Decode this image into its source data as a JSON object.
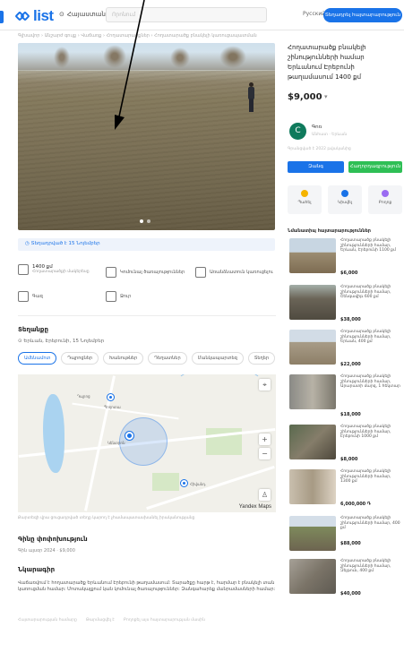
{
  "header": {
    "logo_text": "list",
    "location": "Հայաստան",
    "search_placeholder": "Որոնում",
    "language": "Русский",
    "post_button": "Տեղադրել հայտարարություն"
  },
  "breadcrumb": "Գլխավոր › Անշարժ գույք › Վաճառք › Հողատարածքներ › Հողատարածք բնակելի կառուցապատման",
  "listing": {
    "title": "Հողատարածք բնակելի շինությունների համար Երևանում Էրեբունի թաղամասում 1400 քմ",
    "price": "$9,000",
    "price_caret": "▾",
    "date_line": "Տեղադրված է 15 Նոյեմբեր",
    "features": [
      {
        "value": "1400 քմ",
        "sub": "Հողատարածքի մակերեսը",
        "icon": "area-icon"
      },
      {
        "value": "",
        "sub": "Կոմունալ ծառայություններ",
        "icon": "utilities-icon"
      },
      {
        "value": "",
        "sub": "Առանձնատուն կառուցելու",
        "icon": "house-icon"
      },
      {
        "value": "",
        "sub": "Գազ",
        "icon": "gas-icon"
      },
      {
        "value": "",
        "sub": "Ջուր",
        "icon": "water-icon"
      }
    ]
  },
  "location_section": {
    "title": "Տեղանքը",
    "address": "Երևան, Էրեբունի, 15 Նոյեմբեր",
    "tabs": [
      "Ամենամոտ",
      "Դպրոցներ",
      "Խանութներ",
      "Դեղատներ",
      "Մանկապարտեզ",
      "Տեղեր"
    ],
    "map_labels": [
      "Դպրոց",
      "Պողոտա",
      "Կենտրոն",
      "Հիվանդ."
    ],
    "map_brand": "Yandex Maps",
    "map_note": "Քարտեզի վրա ցուցադրված տեղը կարող է չհամապատասխանել իրականությանը"
  },
  "exchange_section": {
    "title": "Գինը փոփոխություն",
    "line": "Գին այսօր 2024 · $9,000"
  },
  "description_section": {
    "title": "Նկարագիր",
    "text": "Վաճառվում է հողատարածք Երևանում Էրեբունի թաղամասում: Տարածքը հարթ է, հարմար է բնակելի տան կառուցման համար: Մոտակայքում կան կոմունալ ծառայություններ: Զանգահարեք մանրամասների համար:",
    "footer_links": [
      "Հայտարարության համարը",
      "Թարմացվել է",
      "Բողոքել այս հայտարարության մասին"
    ]
  },
  "seller": {
    "avatar_letter": "C",
    "name": "Գոռ",
    "sub": "Անհատ · Երևան",
    "meta": "Գրանցված է 2022 թվականից"
  },
  "buttons": {
    "call": "Զանգ",
    "message": "Հաղորդագրություն"
  },
  "actions": [
    {
      "label": "Պահել",
      "icon": "star-icon",
      "color": "#f5b400"
    },
    {
      "label": "Կիսվել",
      "icon": "share-icon",
      "color": "#1a73e8"
    },
    {
      "label": "Բողոք",
      "icon": "flag-icon",
      "color": "#9b6cf2"
    }
  ],
  "similar": {
    "title": "Նմանատիպ հայտարարություններ",
    "items": [
      {
        "text": "Հողատարածք բնակելի շինությունների համար, Երևան, Էրեբունի 1100 քմ",
        "price": "$6,000"
      },
      {
        "text": "Հողատարածք բնակելի շինությունների համար, Շենգավիթ 600 քմ",
        "price": "$38,000"
      },
      {
        "text": "Հողատարածք բնակելի շինությունների համար, Երևան, 400 քմ",
        "price": "$22,000"
      },
      {
        "text": "Հողատարածք բնակելի շինությունների համար, Արարատի մարզ, 1 հեկտար",
        "price": "$18,000"
      },
      {
        "text": "Հողատարածք բնակելի շինությունների համար, Էրեբունի 1000 քմ",
        "price": "$8,000"
      },
      {
        "text": "Հողատարածք բնակելի շինությունների համար, 1300 քմ",
        "price": "6,000,000 ֏"
      },
      {
        "text": "Հողատարածք բնակելի շինությունների համար, 400 քմ",
        "price": "$88,000"
      },
      {
        "text": "Հողատարածք բնակելի շինությունների համար, Զեյթուն, 400 քմ",
        "price": "$40,000"
      }
    ]
  },
  "colors": {
    "accent": "#1a73e8",
    "green": "#2ebf55"
  }
}
